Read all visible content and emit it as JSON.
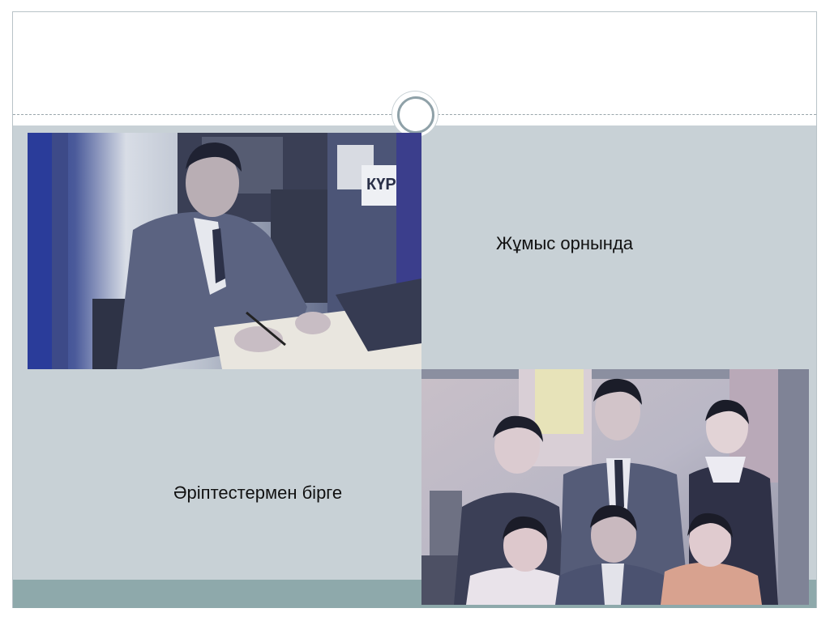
{
  "captions": {
    "workplace": "Жұмыс орнында",
    "with_colleagues": "Әріптестермен бірге"
  },
  "photos": {
    "top_sign_text": "КҮР"
  },
  "colors": {
    "content_bg": "#c8d1d6",
    "footer_band": "#8ea9ab",
    "divider_ring": "#8fa1a8"
  }
}
